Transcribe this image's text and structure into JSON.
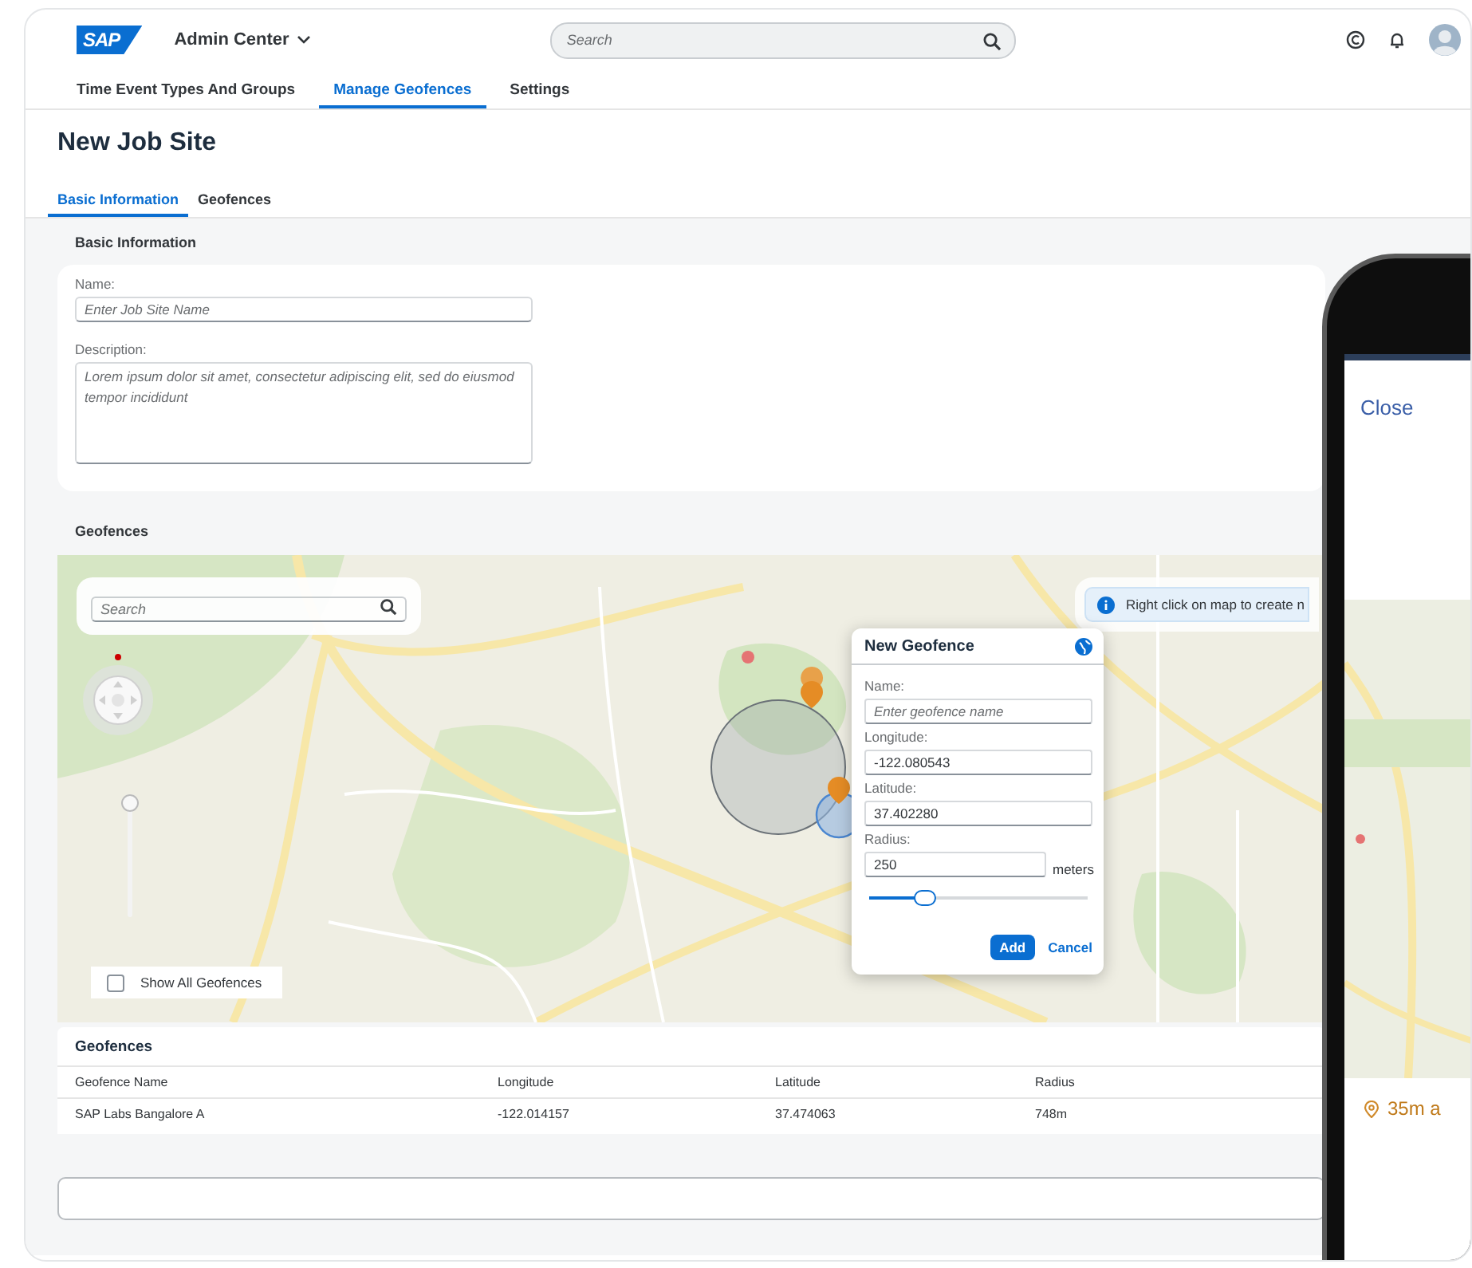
{
  "app": {
    "logo": "SAP",
    "title": "Admin Center",
    "search_placeholder": "Search"
  },
  "nav_tabs": [
    {
      "label": "Time Event Types And Groups",
      "selected": false
    },
    {
      "label": "Manage Geofences",
      "selected": true
    },
    {
      "label": "Settings",
      "selected": false
    }
  ],
  "page_title": "New Job Site",
  "sub_tabs": [
    {
      "label": "Basic Information",
      "selected": true
    },
    {
      "label": "Geofences",
      "selected": false
    }
  ],
  "basic_info": {
    "heading": "Basic Information",
    "name_label": "Name:",
    "name_placeholder": "Enter Job Site Name",
    "description_label": "Description:",
    "description_placeholder": "Lorem ipsum dolor sit amet, consectetur adipiscing elit, sed do eiusmod tempor incididunt"
  },
  "geofences_heading": "Geofences",
  "map": {
    "search_placeholder": "Search",
    "zoom_slider": {
      "level": 1
    },
    "show_all": {
      "label": "Show All Geofences",
      "checked": false
    },
    "info": "Right click on map to create n"
  },
  "popup": {
    "title": "New Geofence",
    "fields": [
      {
        "label": "Name:",
        "placeholder": "Enter geofence name"
      },
      {
        "label": "Longitude:",
        "value": "-122.080543"
      },
      {
        "label": "Latitude:",
        "value": "37.402280"
      },
      {
        "label": "Radius:",
        "value": "250",
        "unit": "meters"
      }
    ],
    "radius_slider": {
      "level": 0.25
    },
    "buttons": [
      {
        "label": "Add",
        "kind": "primary"
      },
      {
        "label": "Cancel",
        "kind": "link"
      }
    ]
  },
  "table": {
    "title": "Geofences",
    "columns": [
      "Geofence Name",
      "Longitude",
      "Latitude",
      "Radius"
    ],
    "rows": [
      [
        "SAP Labs Bangalore A",
        "-122.014157",
        "37.474063",
        "748m"
      ]
    ]
  },
  "phone": {
    "close": "Close",
    "distance": "35m a"
  }
}
